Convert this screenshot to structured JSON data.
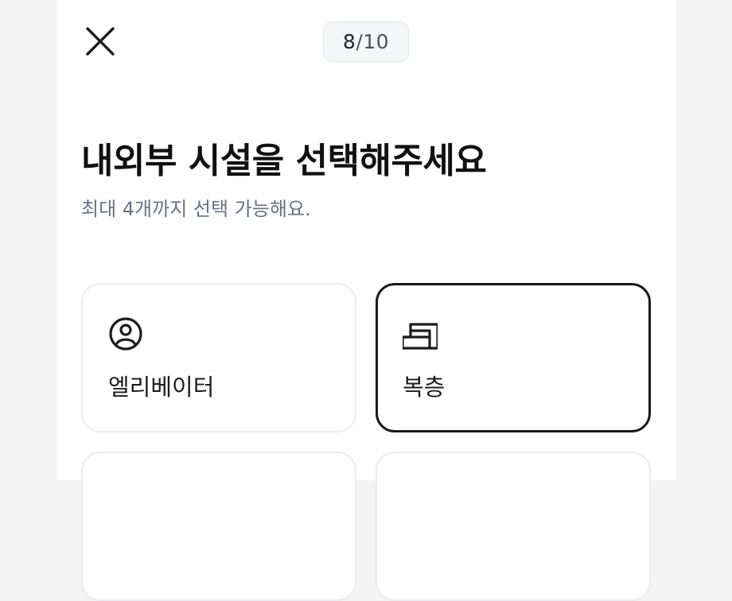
{
  "header": {
    "close_icon": "close-icon",
    "progress": {
      "current": "8",
      "separator": "/",
      "total": "10"
    }
  },
  "main": {
    "title": "내외부 시설을 선택해주세요",
    "subtitle": "최대 4개까지 선택 가능해요."
  },
  "options": [
    {
      "label": "엘리베이터",
      "icon": "elevator-person-icon",
      "selected": false
    },
    {
      "label": "복층",
      "icon": "duplex-floor-icon",
      "selected": true
    }
  ],
  "colors": {
    "background": "#f3f3f3",
    "panel": "#ffffff",
    "selected_border": "#1a1a1a",
    "card_border": "#ececee",
    "subtitle": "#6b7180"
  }
}
